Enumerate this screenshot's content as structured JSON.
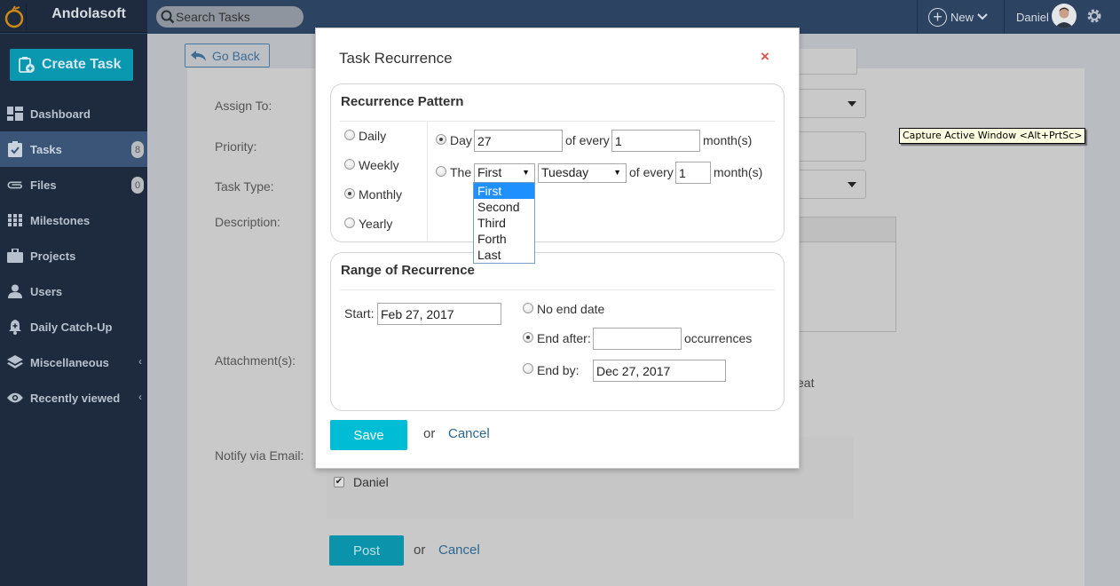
{
  "brand": {
    "name": "Andolasoft"
  },
  "search": {
    "placeholder": "Search Tasks"
  },
  "topbar": {
    "new_label": "New",
    "user_name": "Daniel"
  },
  "sidebar": {
    "create_task_label": "Create Task",
    "items": [
      {
        "label": "Dashboard",
        "icon": "dashboard-icon"
      },
      {
        "label": "Tasks",
        "icon": "tasks-icon",
        "badge": "8",
        "active": true
      },
      {
        "label": "Files",
        "icon": "paperclip-icon",
        "badge": "0"
      },
      {
        "label": "Milestones",
        "icon": "grid-icon"
      },
      {
        "label": "Projects",
        "icon": "briefcase-icon"
      },
      {
        "label": "Users",
        "icon": "user-icon"
      },
      {
        "label": "Daily Catch-Up",
        "icon": "bell-icon"
      },
      {
        "label": "Miscellaneous",
        "icon": "layers-icon",
        "chevron": "‹"
      },
      {
        "label": "Recently viewed",
        "icon": "eye-icon",
        "chevron": "‹"
      }
    ]
  },
  "page": {
    "go_back_label": "Go Back",
    "labels": {
      "assign_to": "Assign To:",
      "priority": "Priority:",
      "task_type": "Task Type:",
      "description": "Description:",
      "attachments": "Attachment(s):",
      "notify_via_email": "Notify via Email:"
    },
    "notify_user": "Daniel",
    "notify_checked": true,
    "partial_text": "eat",
    "post_label": "Post",
    "or_text": "or",
    "cancel_label": "Cancel"
  },
  "tooltip": {
    "text": "Capture Active Window <Alt+PrtSc>"
  },
  "modal": {
    "title": "Task Recurrence",
    "close_symbol": "×",
    "recurrence_pattern": {
      "title": "Recurrence Pattern",
      "frequencies": [
        {
          "label": "Daily",
          "checked": false
        },
        {
          "label": "Weekly",
          "checked": false
        },
        {
          "label": "Monthly",
          "checked": true
        },
        {
          "label": "Yearly",
          "checked": false
        }
      ],
      "day_option": {
        "label": "Day",
        "checked": true,
        "day_value": "27",
        "of_every_label": "of every",
        "months_value": "1",
        "months_label": "month(s)"
      },
      "the_option": {
        "label": "The",
        "checked": false,
        "ordinal_selected": "First",
        "weekday_selected": "Tuesday",
        "of_every_label": "of every",
        "months_value": "1",
        "months_label": "month(s)"
      },
      "ordinal_dropdown": {
        "open": true,
        "options": [
          "First",
          "Second",
          "Third",
          "Forth",
          "Last"
        ],
        "highlighted": "First"
      }
    },
    "range": {
      "title": "Range of Recurrence",
      "start_label": "Start:",
      "start_value": "Feb 27, 2017",
      "no_end_label": "No end date",
      "no_end_checked": false,
      "end_after_label": "End after:",
      "end_after_checked": true,
      "end_after_value": "",
      "occurrences_label": "occurrences",
      "end_by_label": "End by:",
      "end_by_checked": false,
      "end_by_value": "Dec 27, 2017"
    },
    "save_label": "Save",
    "or_text": "or",
    "cancel_label": "Cancel"
  }
}
